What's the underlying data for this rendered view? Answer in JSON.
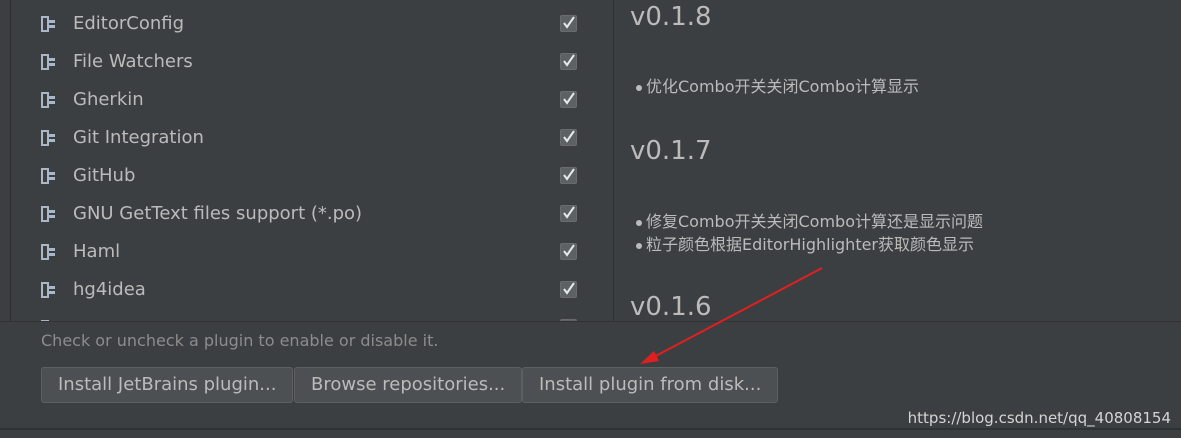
{
  "plugins": [
    {
      "name": "EditorConfig",
      "checked": true
    },
    {
      "name": "File Watchers",
      "checked": true
    },
    {
      "name": "Gherkin",
      "checked": true
    },
    {
      "name": "Git Integration",
      "checked": true
    },
    {
      "name": "GitHub",
      "checked": true
    },
    {
      "name": "GNU GetText files support (*.po)",
      "checked": true
    },
    {
      "name": "Haml",
      "checked": true
    },
    {
      "name": "hg4idea",
      "checked": true
    }
  ],
  "details": {
    "v1": {
      "version": "v0.1.8",
      "notes": [
        "优化Combo开关关闭Combo计算显示"
      ]
    },
    "v2": {
      "version": "v0.1.7",
      "notes": [
        "修复Combo开关关闭Combo计算还是显示问题",
        "粒子颜色根据EditorHighlighter获取颜色显示"
      ]
    },
    "v3": {
      "version": "v0.1.6"
    }
  },
  "footer": {
    "hint": "Check or uncheck a plugin to enable or disable it.",
    "install_jetbrains": "Install JetBrains plugin...",
    "browse_repos": "Browse repositories...",
    "install_disk": "Install plugin from disk..."
  },
  "watermark": "https://blog.csdn.net/qq_40808154",
  "colors": {
    "background": "#3c3f41",
    "text": "#bbbbbb",
    "annotation_arrow": "#e02020"
  },
  "icons": {
    "plugin": "plug-icon",
    "check": "checkmark-icon"
  }
}
